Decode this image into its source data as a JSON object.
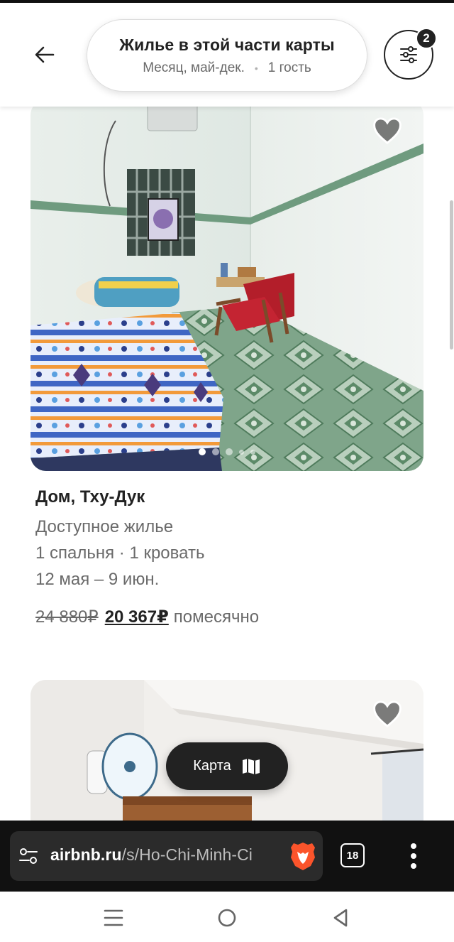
{
  "header": {
    "back_icon": "arrow-left-icon",
    "search_title": "Жилье в этой части карты",
    "search_dates": "Месяц, май-дек.",
    "search_separator": "•",
    "search_guests": "1 гость",
    "filter_icon": "sliders-icon",
    "filter_count": "2"
  },
  "listings": [
    {
      "photo_description_icon": "room-photo",
      "favorite_icon": "heart-icon",
      "photo_count": 5,
      "active_photo_index": 0,
      "title": "Дом, Тху-Дук",
      "subtitle": "Доступное жилье",
      "rooms": "1 спальня · 1 кровать",
      "dates": "12 мая – 9 июн.",
      "old_price": "24 880₽",
      "new_price": "20 367₽",
      "price_period": "помесячно"
    },
    {
      "photo_description_icon": "room-photo",
      "favorite_icon": "heart-icon"
    }
  ],
  "map_button": {
    "label": "Карта",
    "icon": "map-icon"
  },
  "browser": {
    "url_domain": "airbnb.ru",
    "url_path": "/s/Ho-Chi-Minh-Ci",
    "tabs_count": "18",
    "site_settings_icon": "tune-icon",
    "shields_icon": "brave-lion-icon",
    "menu_icon": "more-vertical-icon"
  },
  "android_nav": {
    "recents_icon": "recents-icon",
    "home_icon": "home-circle-icon",
    "back_icon": "back-triangle-icon"
  },
  "colors": {
    "text_primary": "#222222",
    "text_secondary": "#6a6a6a",
    "browser_bar": "#111111",
    "url_box": "#2b2b2b"
  }
}
